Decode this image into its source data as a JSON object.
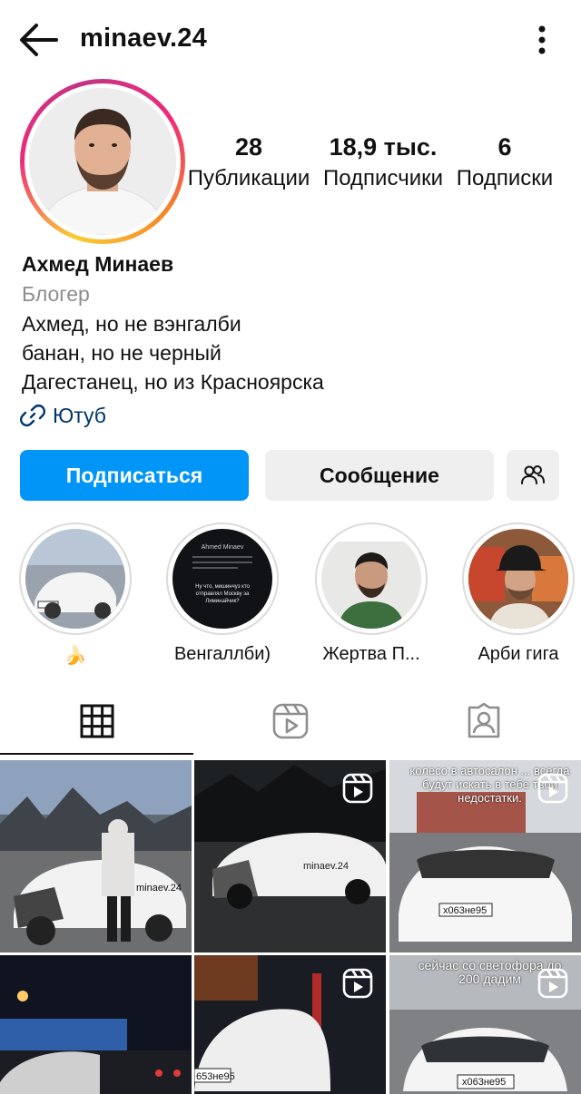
{
  "header": {
    "username": "minaev.24",
    "back_icon": "arrow-left-icon",
    "more_icon": "more-vertical-icon"
  },
  "stats": [
    {
      "value": "28",
      "label": "Публикации"
    },
    {
      "value": "18,9 тыс.",
      "label": "Подписчики"
    },
    {
      "value": "6",
      "label": "Подписки"
    }
  ],
  "profile": {
    "name": "Ахмед Минаев",
    "category": "Блогер",
    "bio": [
      "Ахмед, но не вэнгалби",
      "банан, но не черный",
      "Дагестанец, но из Красноярска"
    ],
    "link_label": "Ютуб"
  },
  "actions": {
    "follow": "Подписаться",
    "message": "Сообщение"
  },
  "highlights": [
    {
      "label": "🍌"
    },
    {
      "label": "Венгаллби)"
    },
    {
      "label": "Жертва П..."
    },
    {
      "label": "Арби гига"
    }
  ],
  "highlight_text": {
    "name_line": "Ahmed Minaev",
    "caption": "Ну что, мишинчуз кто отправлял Москву за Лиминайчик?"
  },
  "tabs": [
    "grid-icon",
    "reels-icon",
    "tagged-icon"
  ],
  "posts": [
    {
      "plate": "",
      "watermark": "minaev.24",
      "overlay": "",
      "reel": false
    },
    {
      "plate": "",
      "watermark": "minaev.24",
      "overlay": "",
      "reel": true
    },
    {
      "plate": "х063не95",
      "watermark": "",
      "overlay": "колесо в автосалон ... всегда будут искать в тебе твои недостатки.",
      "reel": true
    },
    {
      "plate": "",
      "watermark": "",
      "overlay": "",
      "reel": false
    },
    {
      "plate": "653не95",
      "watermark": "",
      "overlay": "",
      "reel": true
    },
    {
      "plate": "х063не95",
      "watermark": "",
      "overlay": "сейчас со светофора до 200 дадим",
      "reel": true
    }
  ],
  "colors": {
    "accent": "#0095f6",
    "link": "#00376b",
    "muted": "#8e8e8e",
    "button_bg": "#efefef"
  }
}
